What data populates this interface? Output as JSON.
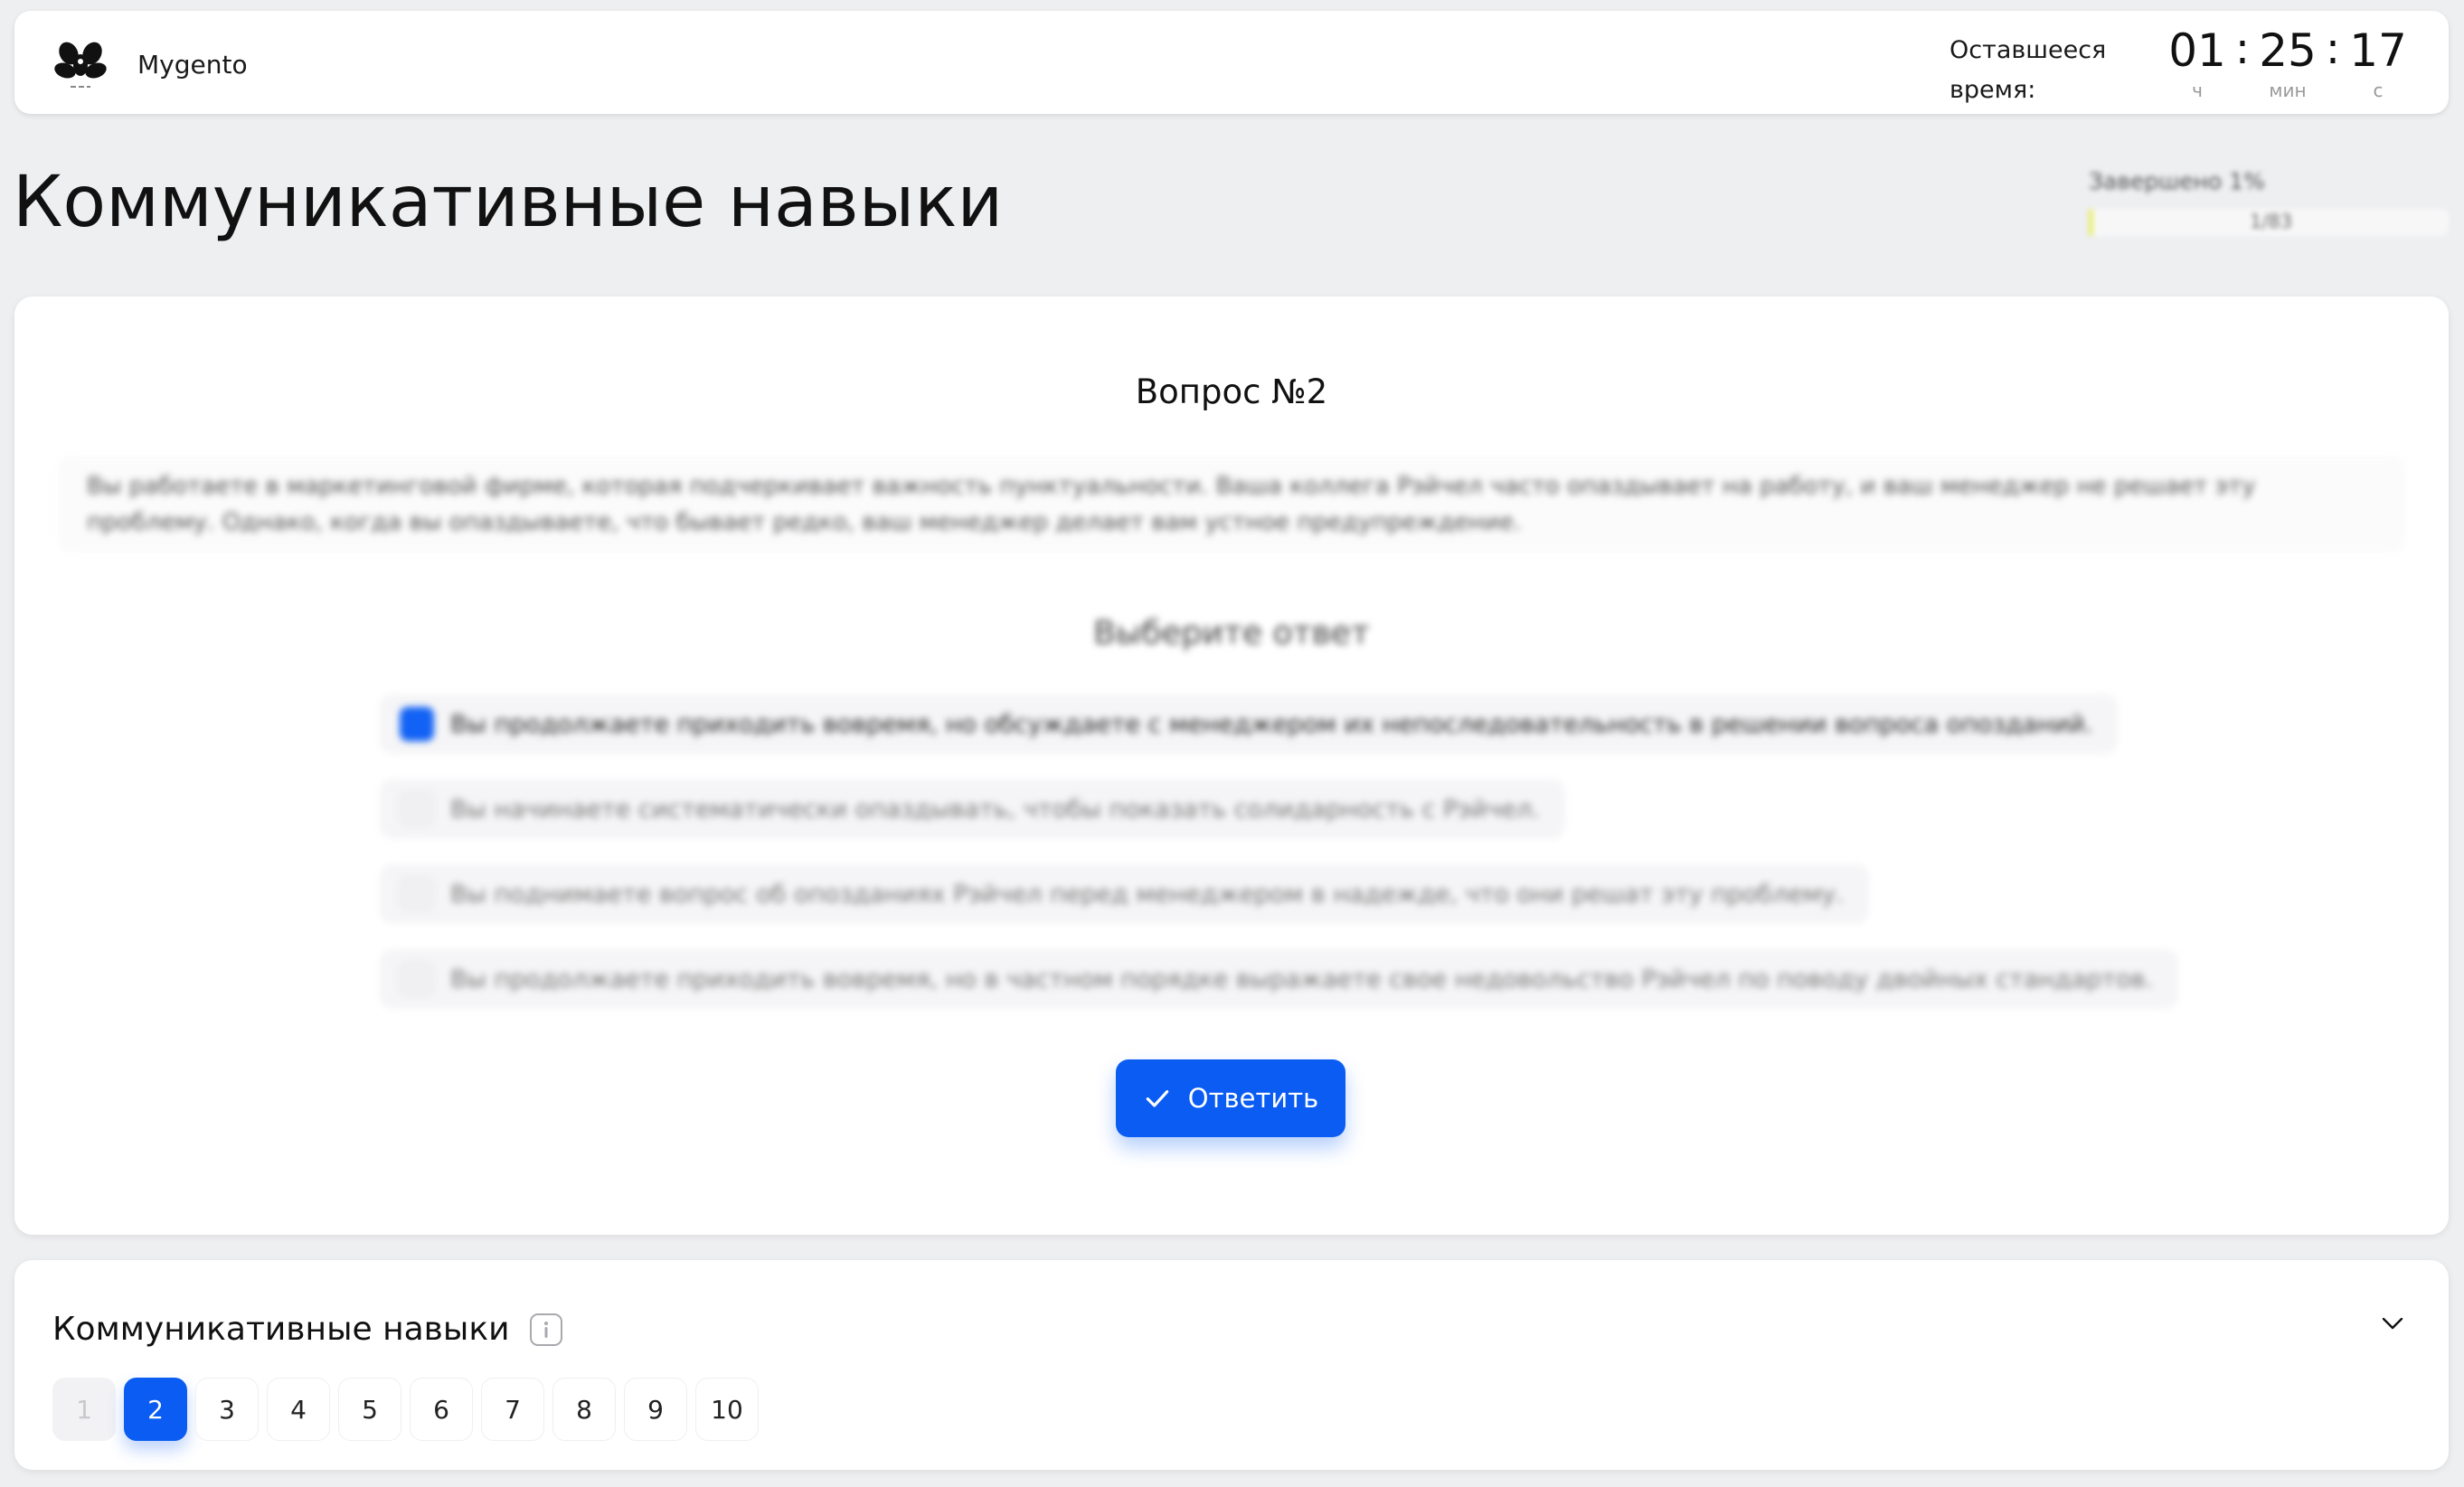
{
  "header": {
    "brand_name": "Mygento",
    "logo_icon": "orchid-logo-icon",
    "timer_label": "Оставшееся время:",
    "timer": {
      "hours": "01",
      "minutes": "25",
      "seconds": "17",
      "hours_caption": "ч",
      "minutes_caption": "мин",
      "seconds_caption": "с",
      "separator": ":"
    }
  },
  "page": {
    "title": "Коммуникативные навыки",
    "progress": {
      "label": "Завершено 1%",
      "count": "1/83",
      "fraction": 0.01,
      "fill_color": "#e9f06a"
    }
  },
  "question": {
    "number_label": "Вопрос №2",
    "text": "Вы работаете в маркетинговой фирме, которая подчеркивает важность пунктуальности. Ваша коллега Рэйчел часто опаздывает на работу, и ваш менеджер не решает эту проблему. Однако, когда вы опаздываете, что бывает редко, ваш менеджер делает вам устное предупреждение.",
    "choose_label": "Выберите ответ",
    "options": [
      {
        "label": "Вы продолжаете приходить вовремя, но обсуждаете с менеджером их непоследовательность в решении вопроса опозданий.",
        "selected": true
      },
      {
        "label": "Вы начинаете систематически опаздывать, чтобы показать солидарность с Рэйчел.",
        "selected": false
      },
      {
        "label": "Вы поднимаете вопрос об опозданиях Рэйчел перед менеджером в надежде, что они решат эту проблему.",
        "selected": false
      },
      {
        "label": "Вы продолжаете приходить вовремя, но в частном порядке выражаете свое недовольство Рэйчел по поводу двойных стандартов.",
        "selected": false
      }
    ],
    "submit_label": "Ответить",
    "submit_icon": "check-icon"
  },
  "navigator": {
    "title": "Коммуникативные навыки",
    "info_icon": "info-icon",
    "collapse_icon": "chevron-down-icon",
    "questions": [
      "1",
      "2",
      "3",
      "4",
      "5",
      "6",
      "7",
      "8",
      "9",
      "10"
    ],
    "answered": [
      "1"
    ],
    "current": "2"
  },
  "colors": {
    "accent": "#0a5cf2",
    "background": "#eeeff1"
  }
}
